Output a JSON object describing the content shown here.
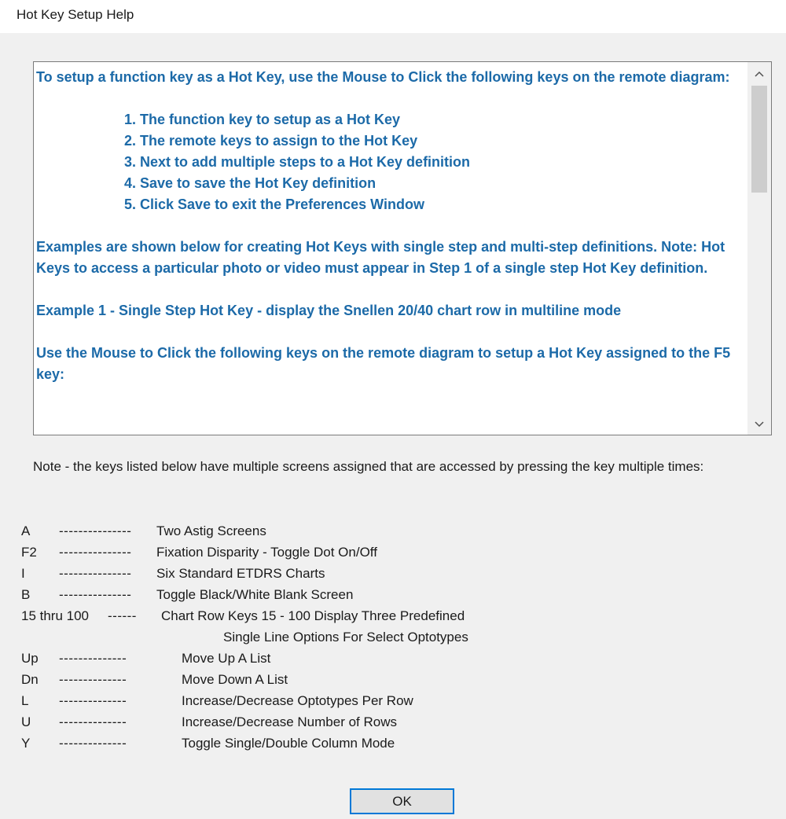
{
  "window": {
    "title": "Hot Key Setup Help"
  },
  "help_text": {
    "intro": "To setup a function key as a Hot Key, use the Mouse to Click the following keys on the remote diagram:",
    "steps": [
      "1.  The function key to setup as a Hot Key",
      "2.  The remote keys to assign to the Hot Key",
      "3.  Next to add multiple steps to a Hot Key definition",
      "4.  Save to save the Hot Key definition",
      "5.  Click Save to exit the Preferences Window"
    ],
    "examples_intro": "Examples are shown below for creating Hot Keys with single step and multi-step definitions. Note: Hot Keys to access a particular photo or video must appear in Step 1 of a single step Hot Key definition.",
    "example_1_title": "Example 1 - Single Step Hot Key - display the Snellen 20/40 chart row in multiline mode",
    "example_1_instructions": "Use the Mouse to Click the following keys on the remote diagram to setup a Hot Key assigned to the F5 key:"
  },
  "scrollbar": {
    "up_icon": "chevron-up-icon",
    "down_icon": "chevron-down-icon"
  },
  "note": "Note - the keys listed below have multiple screens assigned that are accessed by pressing the key multiple times:",
  "key_list": [
    {
      "key": "A",
      "dashes": "---------------",
      "desc": "Two Astig Screens"
    },
    {
      "key": "F2",
      "dashes": "---------------",
      "desc": "Fixation Disparity - Toggle Dot On/Off"
    },
    {
      "key": "I",
      "dashes": "---------------",
      "desc": "Six Standard ETDRS Charts"
    },
    {
      "key": "B",
      "dashes": "---------------",
      "desc": "Toggle Black/White Blank Screen"
    },
    {
      "key": "15 thru 100",
      "dashes": "------",
      "desc": "Chart Row Keys 15 - 100 Display Three Predefined"
    },
    {
      "key": "",
      "dashes": "",
      "desc": "Single Line Options For Select Optotypes"
    },
    {
      "key": "Up",
      "dashes": "--------------",
      "desc": "Move Up A List"
    },
    {
      "key": "Dn",
      "dashes": "--------------",
      "desc": "Move Down A List"
    },
    {
      "key": "L",
      "dashes": "--------------",
      "desc": "Increase/Decrease Optotypes Per Row"
    },
    {
      "key": "U",
      "dashes": "--------------",
      "desc": "Increase/Decrease Number of Rows"
    },
    {
      "key": "Y",
      "dashes": "--------------",
      "desc": "Toggle Single/Double Column Mode"
    }
  ],
  "buttons": {
    "ok": "OK"
  }
}
